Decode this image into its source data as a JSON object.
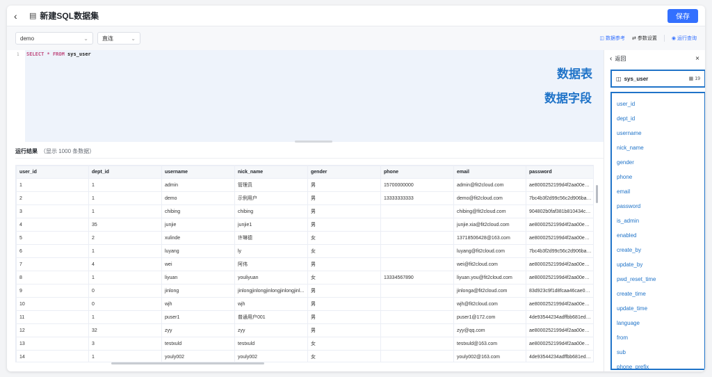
{
  "header": {
    "back_icon": "chevron-left-icon",
    "doc_icon": "document-icon",
    "title": "新建SQL数据集",
    "save_label": "保存"
  },
  "toolbar": {
    "datasource_value": "demo",
    "mode_value": "直连",
    "data_reference_label": "数据参考",
    "params_label": "参数设置",
    "run_label": "运行查询"
  },
  "editor": {
    "line_number": "1",
    "kw_select": "SELECT",
    "star": "*",
    "kw_from": "FROM",
    "table": "sys_user"
  },
  "results": {
    "title": "运行结果",
    "subtitle": "（显示 1000 条数据）",
    "columns": [
      "user_id",
      "dept_id",
      "username",
      "nick_name",
      "gender",
      "phone",
      "email",
      "password"
    ],
    "rows": [
      [
        "1",
        "1",
        "admin",
        "管理员",
        "男",
        "15700000000",
        "admin@fit2cloud.com",
        "ae8000252199d4f2aa00e3b..."
      ],
      [
        "2",
        "1",
        "demo",
        "示例用户",
        "男",
        "13333333333",
        "demo@fit2cloud.com",
        "7bc4b3f2d99c56c2d906ba5..."
      ],
      [
        "3",
        "1",
        "chibing",
        "chibing",
        "男",
        "",
        "chibing@fit2cloud.com",
        "904802b0faf381b810434c0..."
      ],
      [
        "4",
        "35",
        "junjie",
        "junjie1",
        "男",
        "",
        "junjie.xia@fit2cloud.com",
        "ae8000252199d4f2aa00e3b..."
      ],
      [
        "5",
        "2",
        "xulinde",
        "许琳德",
        "女",
        "",
        "13718506428@163.com",
        "ae8000252199d4f2aa00e3b..."
      ],
      [
        "6",
        "1",
        "luyang",
        "ly",
        "女",
        "",
        "luyang@fit2cloud.com",
        "7bc4b3f2d99c56c2d906ba5..."
      ],
      [
        "7",
        "4",
        "wei",
        "阿伟",
        "男",
        "",
        "wei@fit2cloud.com",
        "ae8000252199d4f2aa00e3b..."
      ],
      [
        "8",
        "1",
        "liyuan",
        "youliyuan",
        "女",
        "13334567890",
        "liyuan.you@fit2cloud.com",
        "ae8000252199d4f2aa00e3b..."
      ],
      [
        "9",
        "0",
        "jinlong",
        "jinlongjinlongjinlongjinlongjinl...",
        "男",
        "",
        "jinlonga@fit2cloud.com",
        "83d923c9f1d8fcaa46cae0ed..."
      ],
      [
        "10",
        "0",
        "wjh",
        "wjh",
        "男",
        "",
        "wjh@fit2cloud.com",
        "ae8000252199d4f2aa00e3b..."
      ],
      [
        "11",
        "1",
        "puser1",
        "普通用户001",
        "男",
        "",
        "puser1@172.com",
        "4de93544234adffbb681ed6..."
      ],
      [
        "12",
        "32",
        "zyy",
        "zyy",
        "男",
        "",
        "zyy@qq.com",
        "ae8000252199d4f2aa00e3b..."
      ],
      [
        "13",
        "3",
        "testxuld",
        "testxuld",
        "女",
        "",
        "testxuld@163.com",
        "ae8000252199d4f2aa00e3b..."
      ],
      [
        "14",
        "1",
        "youly002",
        "youly002",
        "女",
        "",
        "youly002@163.com",
        "4de93544234adffbb681ed6..."
      ]
    ]
  },
  "side_panel": {
    "back_label": "返回",
    "table_name": "sys_user",
    "field_count": "19",
    "fields": [
      "user_id",
      "dept_id",
      "username",
      "nick_name",
      "gender",
      "phone",
      "email",
      "password",
      "is_admin",
      "enabled",
      "create_by",
      "update_by",
      "pwd_reset_time",
      "create_time",
      "update_time",
      "language",
      "from",
      "sub",
      "phone_prefix"
    ]
  },
  "annotations": {
    "table_label": "数据表",
    "fields_label": "数据字段"
  },
  "colors": {
    "accent": "#3370ff",
    "annotation": "#1f73c8",
    "keyword": "#c04b7f"
  }
}
